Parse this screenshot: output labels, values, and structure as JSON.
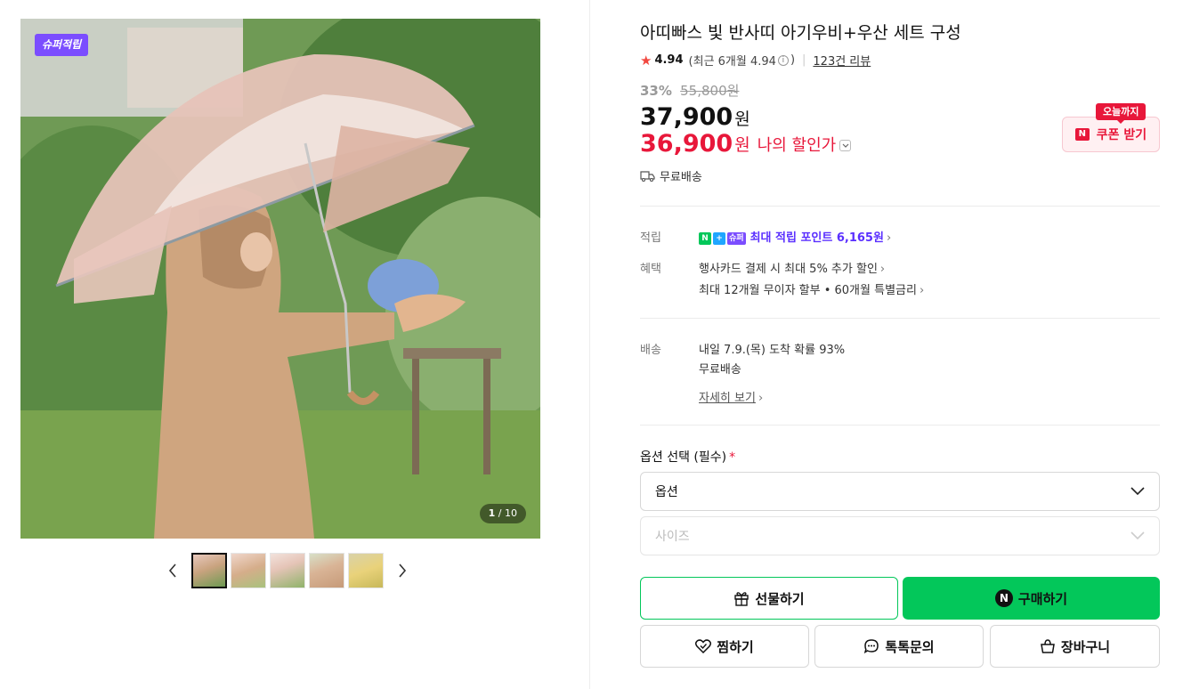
{
  "gallery": {
    "badge": "슈퍼적립",
    "counter_current": "1",
    "counter_total": "/ 10",
    "prev_icon": "chevron-left-icon",
    "next_icon": "chevron-right-icon",
    "thumbnail_count": 5
  },
  "product": {
    "title": "아띠빠스 빛 반사띠 아기우비+우산 세트 구성",
    "rating": {
      "star_icon": "star-icon",
      "score": "4.94",
      "recent_prefix": "(최근 6개월 4.94",
      "recent_suffix": ")",
      "info_glyph": "i",
      "reviews": "123건 리뷰"
    },
    "discount_rate": "33%",
    "original_price": "55,800원",
    "price": "37,900",
    "price_unit": "원",
    "my_price": "36,900",
    "my_price_unit": "원",
    "my_price_label": "나의 할인가",
    "coupon": {
      "tag": "오늘까지",
      "icon_letter": "N",
      "label": "쿠폰 받기"
    },
    "shipping_summary": "무료배송"
  },
  "details": {
    "points": {
      "key": "적립",
      "badges": [
        "N",
        "+",
        "슈퍼"
      ],
      "text": "최대 적립 포인트 6,165원"
    },
    "benefits": {
      "key": "혜택",
      "line1": "행사카드 결제 시 최대 5% 추가 할인",
      "line2": "최대 12개월 무이자 할부 • 60개월 특별금리"
    },
    "delivery": {
      "key": "배송",
      "line1": "내일 7.9.(목) 도착 확률 93%",
      "line2": "무료배송",
      "more": "자세히 보기"
    }
  },
  "options": {
    "label": "옵션 선택 (필수)",
    "required_mark": "*",
    "option_value": "옵션",
    "size_value": "사이즈"
  },
  "actions": {
    "gift": "선물하기",
    "buy": "구매하기",
    "buy_icon_letter": "N",
    "wish": "찜하기",
    "talk": "톡톡문의",
    "cart": "장바구니"
  },
  "colors": {
    "naver_green": "#03c75a",
    "price_red": "#e8173a",
    "super_purple": "#7b4dff"
  }
}
